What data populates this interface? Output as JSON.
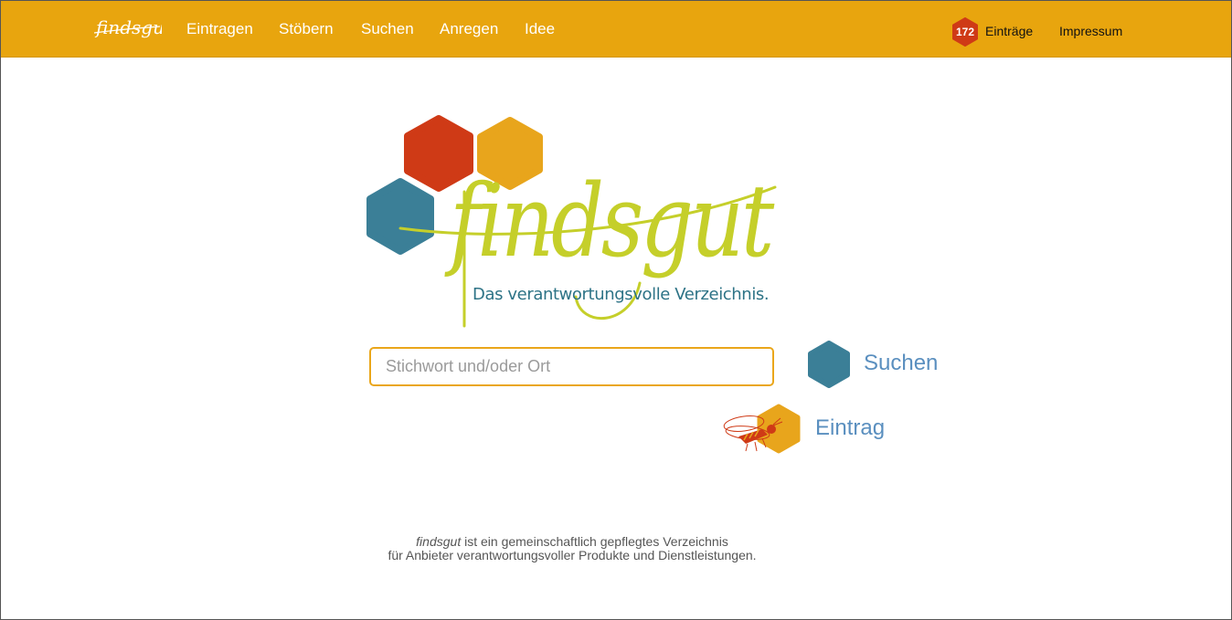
{
  "navbar": {
    "brand": "findsgut",
    "links": [
      {
        "label": "Eintragen"
      },
      {
        "label": "Stöbern"
      },
      {
        "label": "Suchen"
      },
      {
        "label": "Anregen"
      },
      {
        "label": "Idee"
      }
    ],
    "entry_count": "172",
    "entry_count_label": "Einträge",
    "impressum": "Impressum"
  },
  "logo": {
    "wordmark": "findsgut",
    "tagline": "Das verantwortungsvolle Verzeichnis."
  },
  "search": {
    "placeholder": "Stichwort und/oder Ort",
    "value": "",
    "button_label": "Suchen"
  },
  "entry": {
    "button_label": "Eintrag",
    "icon": "bee-icon"
  },
  "footer": {
    "brand": "findsgut",
    "line1_rest": " ist ein gemeinschaftlich gepflegtes Verzeichnis",
    "line2": "für Anbieter verantwortungsvoller Produkte und Dienstleistungen."
  },
  "colors": {
    "navbar": "#e8a50e",
    "hex_red": "#cf3a16",
    "hex_orange": "#e8a51c",
    "hex_teal": "#3b7f97",
    "wordmark_green": "#c5cf2a",
    "tagline": "#2d7386",
    "button_text": "#5a8fbf"
  }
}
